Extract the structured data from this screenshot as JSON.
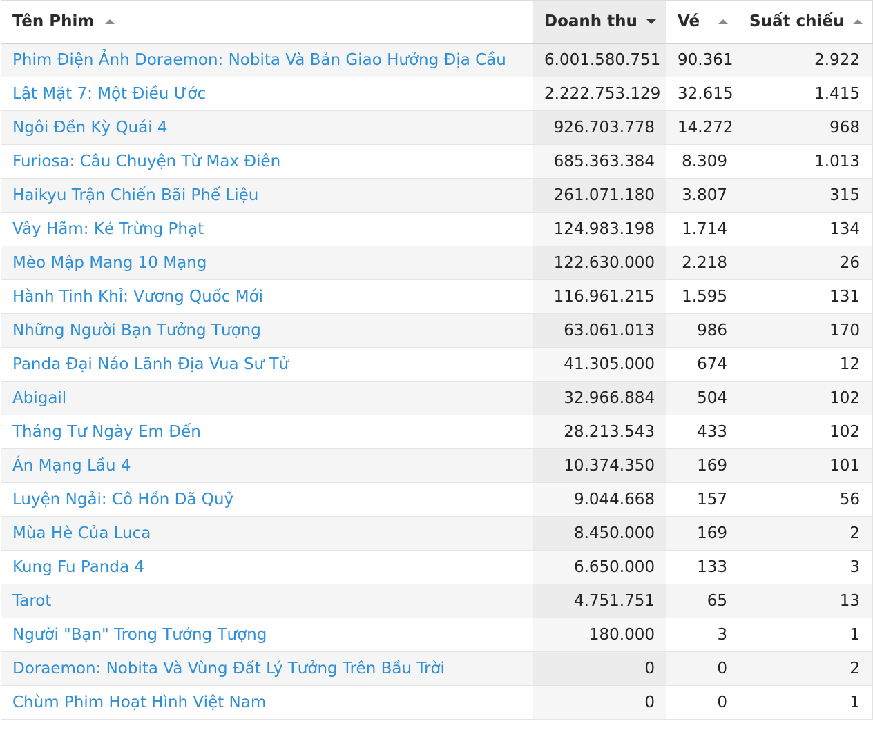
{
  "table": {
    "columns": [
      {
        "label": "Tên Phim",
        "sort": "up"
      },
      {
        "label": "Doanh thu",
        "sort": "down"
      },
      {
        "label": "Vé",
        "sort": "up"
      },
      {
        "label": "Suất chiếu",
        "sort": "up"
      }
    ],
    "rows": [
      {
        "name": "Phim Điện Ảnh Doraemon: Nobita Và Bản Giao Hưởng Địa Cầu",
        "revenue": "6.001.580.751",
        "tickets": "90.361",
        "showtimes": "2.922"
      },
      {
        "name": "Lật Mặt 7: Một Điều Ước",
        "revenue": "2.222.753.129",
        "tickets": "32.615",
        "showtimes": "1.415"
      },
      {
        "name": "Ngôi Đền Kỳ Quái 4",
        "revenue": "926.703.778",
        "tickets": "14.272",
        "showtimes": "968"
      },
      {
        "name": "Furiosa: Câu Chuyện Từ Max Điên",
        "revenue": "685.363.384",
        "tickets": "8.309",
        "showtimes": "1.013"
      },
      {
        "name": "Haikyu Trận Chiến Bãi Phế Liệu",
        "revenue": "261.071.180",
        "tickets": "3.807",
        "showtimes": "315"
      },
      {
        "name": "Vây Hãm: Kẻ Trừng Phạt",
        "revenue": "124.983.198",
        "tickets": "1.714",
        "showtimes": "134"
      },
      {
        "name": "Mèo Mập Mang 10 Mạng",
        "revenue": "122.630.000",
        "tickets": "2.218",
        "showtimes": "26"
      },
      {
        "name": "Hành Tinh Khỉ: Vương Quốc Mới",
        "revenue": "116.961.215",
        "tickets": "1.595",
        "showtimes": "131"
      },
      {
        "name": "Những Người Bạn Tưởng Tượng",
        "revenue": "63.061.013",
        "tickets": "986",
        "showtimes": "170"
      },
      {
        "name": "Panda Đại Náo Lãnh Địa Vua Sư Tử",
        "revenue": "41.305.000",
        "tickets": "674",
        "showtimes": "12"
      },
      {
        "name": "Abigail",
        "revenue": "32.966.884",
        "tickets": "504",
        "showtimes": "102"
      },
      {
        "name": "Tháng Tư Ngày Em Đến",
        "revenue": "28.213.543",
        "tickets": "433",
        "showtimes": "102"
      },
      {
        "name": "Án Mạng Lầu 4",
        "revenue": "10.374.350",
        "tickets": "169",
        "showtimes": "101"
      },
      {
        "name": "Luyện Ngải: Cô Hồn Dã Quỷ",
        "revenue": "9.044.668",
        "tickets": "157",
        "showtimes": "56"
      },
      {
        "name": "Mùa Hè Của Luca",
        "revenue": "8.450.000",
        "tickets": "169",
        "showtimes": "2"
      },
      {
        "name": "Kung Fu Panda 4",
        "revenue": "6.650.000",
        "tickets": "133",
        "showtimes": "3"
      },
      {
        "name": "Tarot",
        "revenue": "4.751.751",
        "tickets": "65",
        "showtimes": "13"
      },
      {
        "name": "Người \"Bạn\" Trong Tưởng Tượng",
        "revenue": "180.000",
        "tickets": "3",
        "showtimes": "1"
      },
      {
        "name": "Doraemon: Nobita Và Vùng Đất Lý Tưởng Trên Bầu Trời",
        "revenue": "0",
        "tickets": "0",
        "showtimes": "2"
      },
      {
        "name": "Chùm Phim Hoạt Hình Việt Nam",
        "revenue": "0",
        "tickets": "0",
        "showtimes": "1"
      }
    ]
  }
}
